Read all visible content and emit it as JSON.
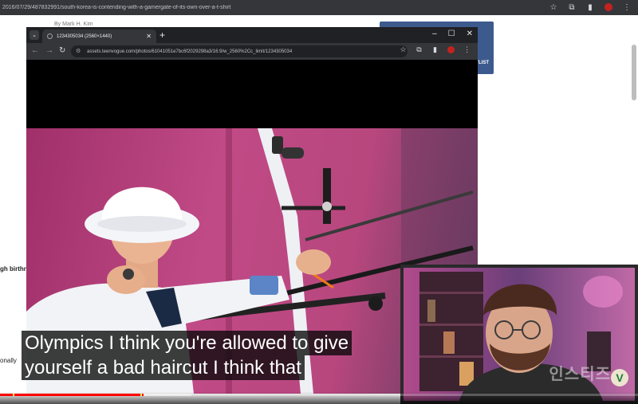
{
  "background_browser": {
    "url": "2016/07/29/487832991/south-korea-is-contending-with-a-gamergate-of-its-own-over-a-t-shirt",
    "byline": "By Mark H. Kim",
    "card_text": "YLIST",
    "left_snippet_1": "gh birthrate in",
    "left_snippet_2": "onally"
  },
  "popup": {
    "tab_title": "1234305034 (2560×1440)",
    "url": "assets.teenvogue.com/photos/61041051e7bc6f2029298a3/16:9/w_2560%2Cc_limit/1234305034",
    "window_controls": [
      "–",
      "☐",
      "✕"
    ]
  },
  "subtitles": {
    "line1": "Olympics I think you're allowed to give",
    "line2": "yourself a bad haircut I think that"
  },
  "webcam": {
    "watermark": "인스티즈",
    "logo": "V"
  },
  "player": {
    "played_fraction": 0.225,
    "buffered_fraction": 0.3,
    "chapter_markers": [
      0.02,
      0.22
    ]
  },
  "colors": {
    "accent": "#ff0000",
    "photo_bg": "#b8477e"
  }
}
